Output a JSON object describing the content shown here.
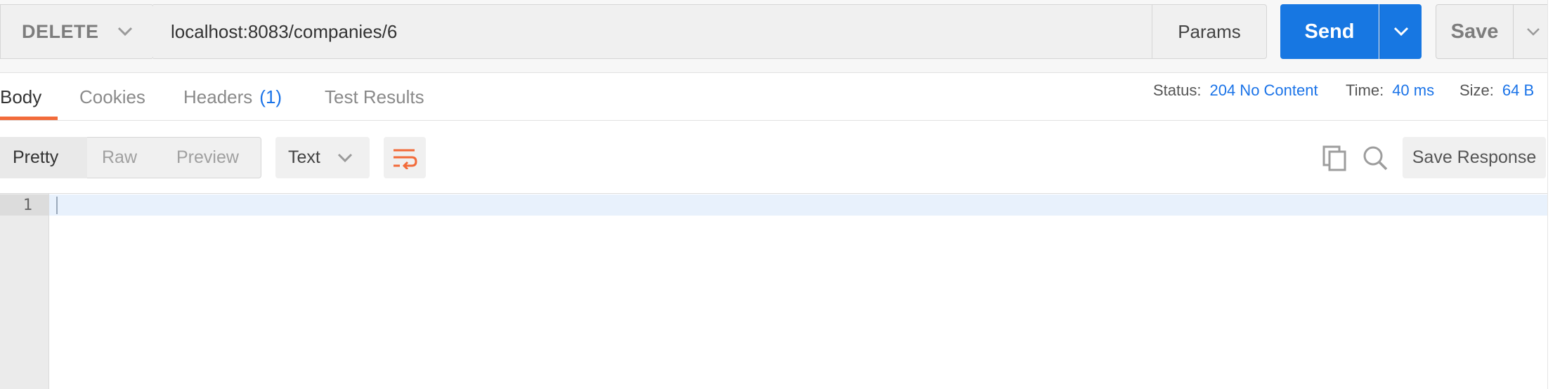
{
  "request": {
    "method": "DELETE",
    "url": "localhost:8083/companies/6",
    "params_label": "Params",
    "send_label": "Send",
    "save_label": "Save"
  },
  "response_tabs": [
    {
      "label": "Body",
      "active": true
    },
    {
      "label": "Cookies",
      "active": false
    },
    {
      "label": "Headers",
      "count": "(1)",
      "active": false
    },
    {
      "label": "Test Results",
      "active": false
    }
  ],
  "response_meta": {
    "status_label": "Status:",
    "status_value": "204 No Content",
    "time_label": "Time:",
    "time_value": "40 ms",
    "size_label": "Size:",
    "size_value": "64 B"
  },
  "viewer": {
    "modes": [
      "Pretty",
      "Raw",
      "Preview"
    ],
    "active_mode": "Pretty",
    "format": "Text",
    "save_response_label": "Save Response"
  },
  "editor": {
    "lines": [
      "1"
    ]
  },
  "colors": {
    "send_blue": "#1777e2",
    "link_blue": "#1a73e8",
    "tab_underline_orange": "#f26b3a"
  },
  "icons": [
    "chevron-down-icon",
    "wrap-lines-icon",
    "copy-icon",
    "search-icon"
  ]
}
